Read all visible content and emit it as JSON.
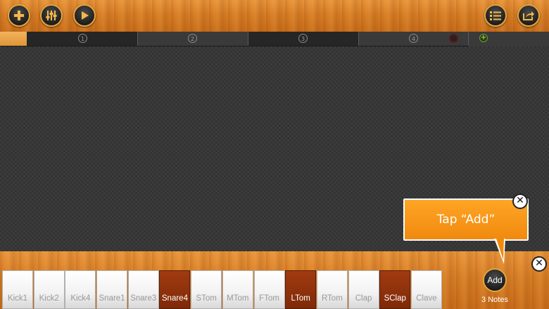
{
  "toolbar": {
    "left_buttons": [
      "add-icon",
      "mixer-icon",
      "play-icon"
    ],
    "right_buttons": [
      "list-icon",
      "share-icon"
    ],
    "accent": "#e0a640"
  },
  "timeline": {
    "bar_numbers": [
      "1",
      "2",
      "3",
      "4"
    ]
  },
  "tooltip": {
    "text": "Tap “Add”",
    "color": "#f08a0e"
  },
  "keys": [
    {
      "label": "Kick1",
      "active": false
    },
    {
      "label": "Kick2",
      "active": false
    },
    {
      "label": "Kick4",
      "active": false
    },
    {
      "label": "Snare1",
      "active": false
    },
    {
      "label": "Snare3",
      "active": false
    },
    {
      "label": "Snare4",
      "active": true
    },
    {
      "label": "STom",
      "active": false
    },
    {
      "label": "MTom",
      "active": false
    },
    {
      "label": "FTom",
      "active": false
    },
    {
      "label": "LTom",
      "active": true
    },
    {
      "label": "RTom",
      "active": false
    },
    {
      "label": "Clap",
      "active": false
    },
    {
      "label": "SClap",
      "active": true
    },
    {
      "label": "Clave",
      "active": false
    }
  ],
  "add_button": {
    "label": "Add"
  },
  "notes_count": "3 Notes"
}
